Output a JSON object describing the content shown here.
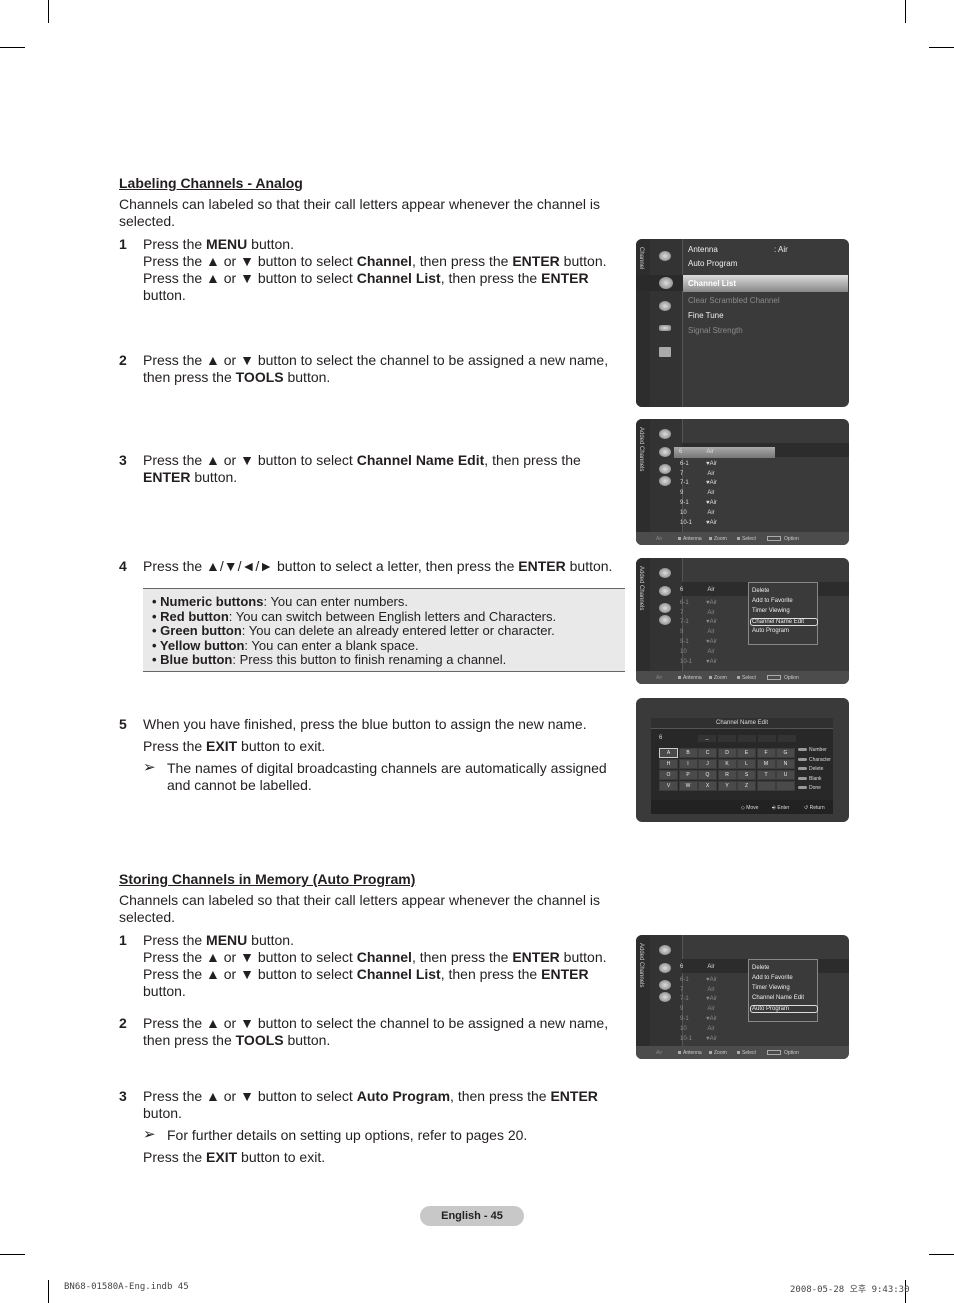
{
  "section1": {
    "heading": "Labeling Channels - Analog",
    "intro": "Channels can labeled so that their call letters appear whenever the channel is selected.",
    "steps": [
      {
        "num": "1",
        "lines": [
          [
            "Press the ",
            "MENU",
            " button."
          ],
          [
            "Press the ▲ or ▼ button to select ",
            "Channel",
            ", then press the ",
            "ENTER",
            " button."
          ],
          [
            "Press the ▲ or ▼ button to select ",
            "Channel List",
            ", then press the ",
            "ENTER",
            " button."
          ]
        ]
      },
      {
        "num": "2",
        "lines": [
          [
            "Press the ▲ or ▼ button to select the channel to be assigned a new name, then press the ",
            "TOOLS",
            " button."
          ]
        ]
      },
      {
        "num": "3",
        "lines": [
          [
            "Press the ▲ or ▼ button to select ",
            "Channel Name Edit",
            ", then press the ",
            "ENTER",
            " button."
          ]
        ]
      },
      {
        "num": "4",
        "lines": [
          [
            "Press the ▲/▼/◄/► button to select a letter, then press the ",
            "ENTER",
            " button."
          ]
        ]
      },
      {
        "num": "5",
        "lines": [
          [
            "When you have finished, press the blue button to assign the new name."
          ],
          [
            "Press the ",
            "EXIT",
            " button to exit."
          ]
        ],
        "note": "The names of digital broadcasting channels are automatically assigned and cannot be labelled."
      }
    ],
    "tips": [
      {
        "label": "Numeric buttons",
        "text": ": You can enter numbers."
      },
      {
        "label": "Red button",
        "text": ": You can switch between English letters and Characters."
      },
      {
        "label": "Green button",
        "text": ": You can delete an already entered letter or character."
      },
      {
        "label": "Yellow button",
        "text": ": You can enter a blank space."
      },
      {
        "label": "Blue button",
        "text": ": Press this button to finish renaming a channel."
      }
    ]
  },
  "section2": {
    "heading": "Storing Channels in Memory (Auto Program)",
    "intro": "Channels can labeled so that their call letters appear whenever the channel is selected.",
    "steps": [
      {
        "num": "1",
        "lines": [
          [
            "Press the ",
            "MENU",
            " button."
          ],
          [
            "Press the ▲ or ▼ button to select ",
            "Channel",
            ", then press the ",
            "ENTER",
            " button."
          ],
          [
            "Press the ▲ or ▼ button to select ",
            "Channel List",
            ", then press the ",
            "ENTER",
            " button."
          ]
        ]
      },
      {
        "num": "2",
        "lines": [
          [
            "Press the ▲ or ▼ button to select the channel to be assigned a new name, then press the ",
            "TOOLS",
            " button."
          ]
        ]
      },
      {
        "num": "3",
        "lines": [
          [
            "Press the ▲ or ▼ button to select ",
            "Auto Program",
            ", then press the ",
            "ENTER",
            " buton."
          ]
        ],
        "note": "For further details on setting up options, refer to pages 20.",
        "after": [
          "Press the ",
          "EXIT",
          " button to exit."
        ]
      }
    ]
  },
  "screens": {
    "channel_menu": {
      "side_label": "Channel",
      "items": [
        {
          "label": "Antenna",
          "value": ": Air",
          "state": "normal"
        },
        {
          "label": "Auto Program",
          "state": "normal"
        },
        {
          "label": "Channel List",
          "state": "selected"
        },
        {
          "label": "Clear Scrambled Channel",
          "state": "disabled"
        },
        {
          "label": "Fine Tune",
          "state": "normal"
        },
        {
          "label": "Signal Strength",
          "state": "disabled"
        }
      ]
    },
    "channel_list": {
      "side_label": "Added Channels",
      "rows": [
        {
          "ch": "6",
          "type": "Air",
          "fav": false
        },
        {
          "ch": "6-1",
          "type": "Air",
          "fav": true
        },
        {
          "ch": "7",
          "type": "Air",
          "fav": false
        },
        {
          "ch": "7-1",
          "type": "Air",
          "fav": true
        },
        {
          "ch": "9",
          "type": "Air",
          "fav": false
        },
        {
          "ch": "9-1",
          "type": "Air",
          "fav": true
        },
        {
          "ch": "10",
          "type": "Air",
          "fav": false
        },
        {
          "ch": "10-1",
          "type": "Air",
          "fav": true
        }
      ],
      "footer": {
        "mode": "Air",
        "antenna": "Antenna",
        "zoom": "Zoom",
        "select": "Select",
        "option": "Option"
      }
    },
    "tools_popup": {
      "items": [
        "Delete",
        "Add to Favorite",
        "Timer Viewing",
        "Channel Name Edit",
        "Auto Program"
      ],
      "selected_first": "Channel Name Edit",
      "selected_second": "Auto Program"
    },
    "name_edit": {
      "title": "Channel Name Edit",
      "channel": "6",
      "cursor": "_",
      "keys": [
        "A",
        "B",
        "C",
        "D",
        "E",
        "F",
        "G",
        "H",
        "I",
        "J",
        "K",
        "L",
        "M",
        "N",
        "O",
        "P",
        "Q",
        "R",
        "S",
        "T",
        "U",
        "V",
        "W",
        "X",
        "Y",
        "Z",
        "",
        ""
      ],
      "selected_key": "A",
      "legend": [
        "Number",
        "Character",
        "Delete",
        "Blank",
        "Done"
      ],
      "footer": {
        "move": "Move",
        "enter": "Enter",
        "return": "Return"
      }
    }
  },
  "footer": {
    "page_label": "English - 45",
    "slug_left": "BN68-01580A-Eng.indb   45",
    "slug_right": "2008-05-28   오후 9:43:30"
  }
}
